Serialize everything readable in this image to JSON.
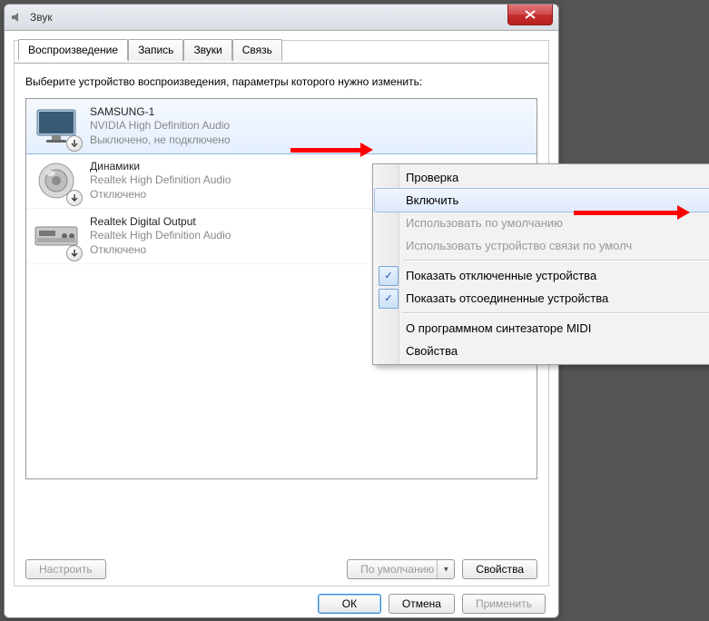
{
  "title": "Звук",
  "tabs": [
    "Воспроизведение",
    "Запись",
    "Звуки",
    "Связь"
  ],
  "instruction": "Выберите устройство воспроизведения, параметры которого нужно изменить:",
  "devices": [
    {
      "name": "SAMSUNG-1",
      "driver": "NVIDIA High Definition Audio",
      "status": "Выключено, не подключено",
      "icon": "monitor"
    },
    {
      "name": "Динамики",
      "driver": "Realtek High Definition Audio",
      "status": "Отключено",
      "icon": "speaker"
    },
    {
      "name": "Realtek Digital Output",
      "driver": "Realtek High Definition Audio",
      "status": "Отключено",
      "icon": "receiver"
    }
  ],
  "buttons": {
    "configure": "Настроить",
    "default": "По умолчанию",
    "properties": "Свойства",
    "ok": "ОК",
    "cancel": "Отмена",
    "apply": "Применить"
  },
  "context": {
    "test": "Проверка",
    "enable": "Включить",
    "setDefault": "Использовать по умолчанию",
    "setDefaultComm": "Использовать устройство связи по умолч",
    "showDisabled": "Показать отключенные устройства",
    "showDisconnected": "Показать отсоединенные устройства",
    "midi": "О программном синтезаторе MIDI",
    "props": "Свойства"
  }
}
